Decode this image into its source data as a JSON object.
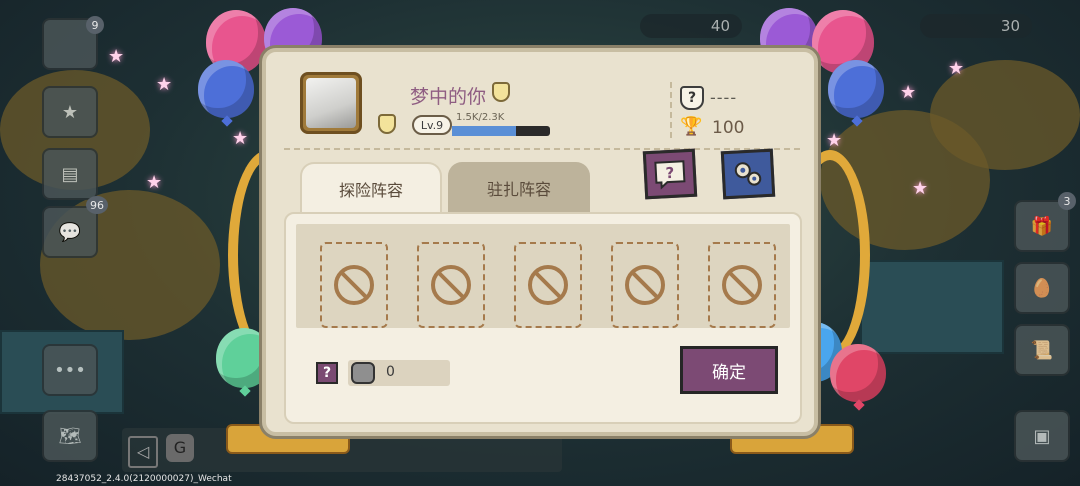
{
  "player": {
    "name": "梦中的你",
    "level_label": "Lv.9",
    "xp_text": "1.5K/2.3K",
    "xp_fraction": 0.65,
    "rank_symbol": "?",
    "rank_text": "----",
    "trophies": "100"
  },
  "tabs": [
    {
      "label": "探险阵容",
      "active": true
    },
    {
      "label": "驻扎阵容",
      "active": false
    }
  ],
  "toolbar": {
    "help_icon": "question-mark-icon",
    "settings_icon": "gears-icon"
  },
  "slots": [
    "empty",
    "empty",
    "empty",
    "empty",
    "empty"
  ],
  "footer": {
    "help_symbol": "?",
    "power_value": "0",
    "confirm_label": "确定"
  },
  "background": {
    "top_counter_left": "40",
    "top_counter_right": "30",
    "badge_top_left": "9",
    "badge_side": "96",
    "badge_right": "3",
    "version_text": "28437052_2.4.0(2120000027)_Wechat"
  },
  "colors": {
    "accent_purple": "#7c4a74",
    "dialog_bg": "#e9e2cf",
    "name_color": "#8f5d82",
    "xp_fill": "#5a8fd6"
  }
}
